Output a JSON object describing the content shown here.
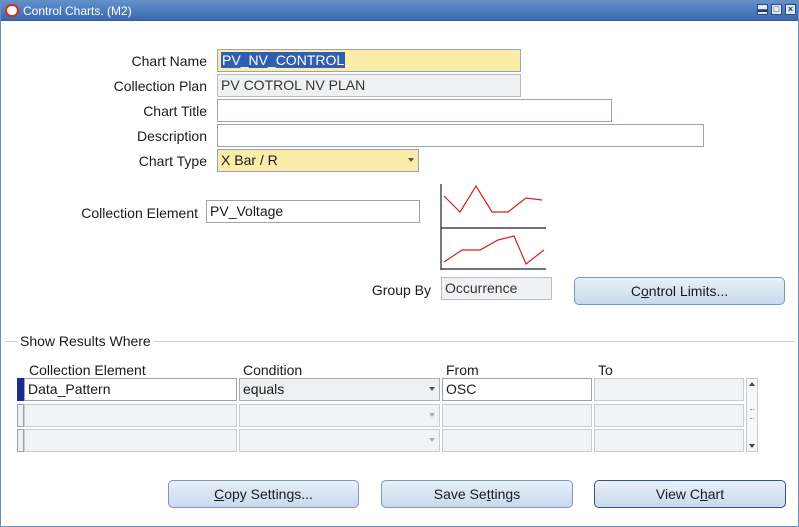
{
  "window": {
    "title": "Control Charts. (M2)",
    "controls": [
      "minimize-icon",
      "maximize-icon",
      "close-icon"
    ]
  },
  "form": {
    "chart_name": {
      "label": "Chart Name",
      "value": "PV_NV_CONTROL"
    },
    "collection_plan": {
      "label": "Collection Plan",
      "value": "PV COTROL NV PLAN"
    },
    "chart_title": {
      "label": "Chart Title",
      "value": ""
    },
    "description": {
      "label": "Description",
      "value": ""
    },
    "chart_type": {
      "label": "Chart Type",
      "value": "X Bar / R"
    },
    "collection_element": {
      "label": "Collection Element",
      "value": "PV_Voltage"
    },
    "group_by": {
      "label": "Group By",
      "value": "Occurrence"
    },
    "control_limits_button": {
      "label_pre": "C",
      "label_u": "o",
      "label_post": "ntrol Limits..."
    }
  },
  "results": {
    "section_title": "Show Results Where",
    "columns": [
      "Collection Element",
      "Condition",
      "From",
      "To"
    ],
    "rows": [
      {
        "element": "Data_Pattern",
        "condition": "equals",
        "from": "OSC",
        "to": ""
      },
      {
        "element": "",
        "condition": "",
        "from": "",
        "to": ""
      },
      {
        "element": "",
        "condition": "",
        "from": "",
        "to": ""
      }
    ]
  },
  "buttons": {
    "copy_settings": {
      "label_pre": "",
      "label_u": "C",
      "label_post": "opy Settings..."
    },
    "save_settings": {
      "label_pre": "Save Se",
      "label_u": "t",
      "label_post": "tings"
    },
    "view_chart": {
      "label_pre": "View C",
      "label_u": "h",
      "label_post": "art"
    }
  },
  "colors": {
    "titlebar": "#4a7cc0",
    "required_field": "#fcecaa",
    "selection": "#2f5fb3",
    "chart_line": "#d42020"
  }
}
